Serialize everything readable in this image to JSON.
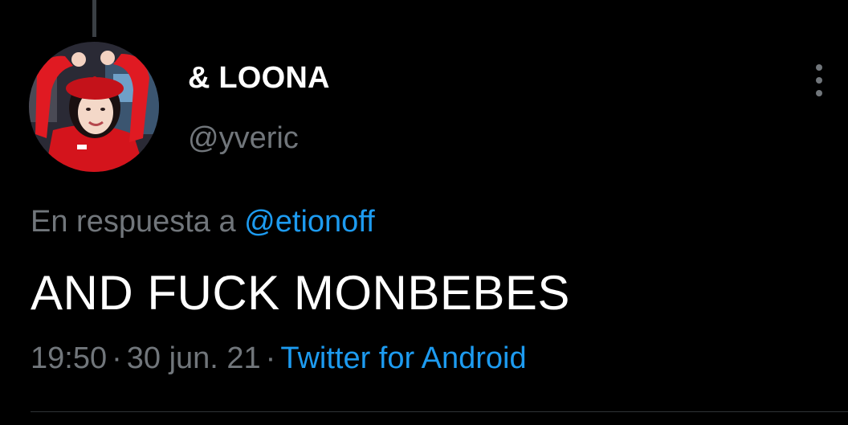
{
  "tweet": {
    "display_name": "& LOONA",
    "handle": "@yveric",
    "reply_prefix": "En respuesta a",
    "reply_to": "@etionoff",
    "text": "AND FUCK MONBEBES",
    "time": "19:50",
    "date": "30 jun. 21",
    "separator": "·",
    "source": "Twitter for Android"
  },
  "icons": {
    "more": "more-vertical-icon",
    "avatar": "profile-avatar"
  },
  "colors": {
    "background": "#000000",
    "text_primary": "#ffffff",
    "text_secondary": "#71767b",
    "link": "#1d9bf0"
  }
}
